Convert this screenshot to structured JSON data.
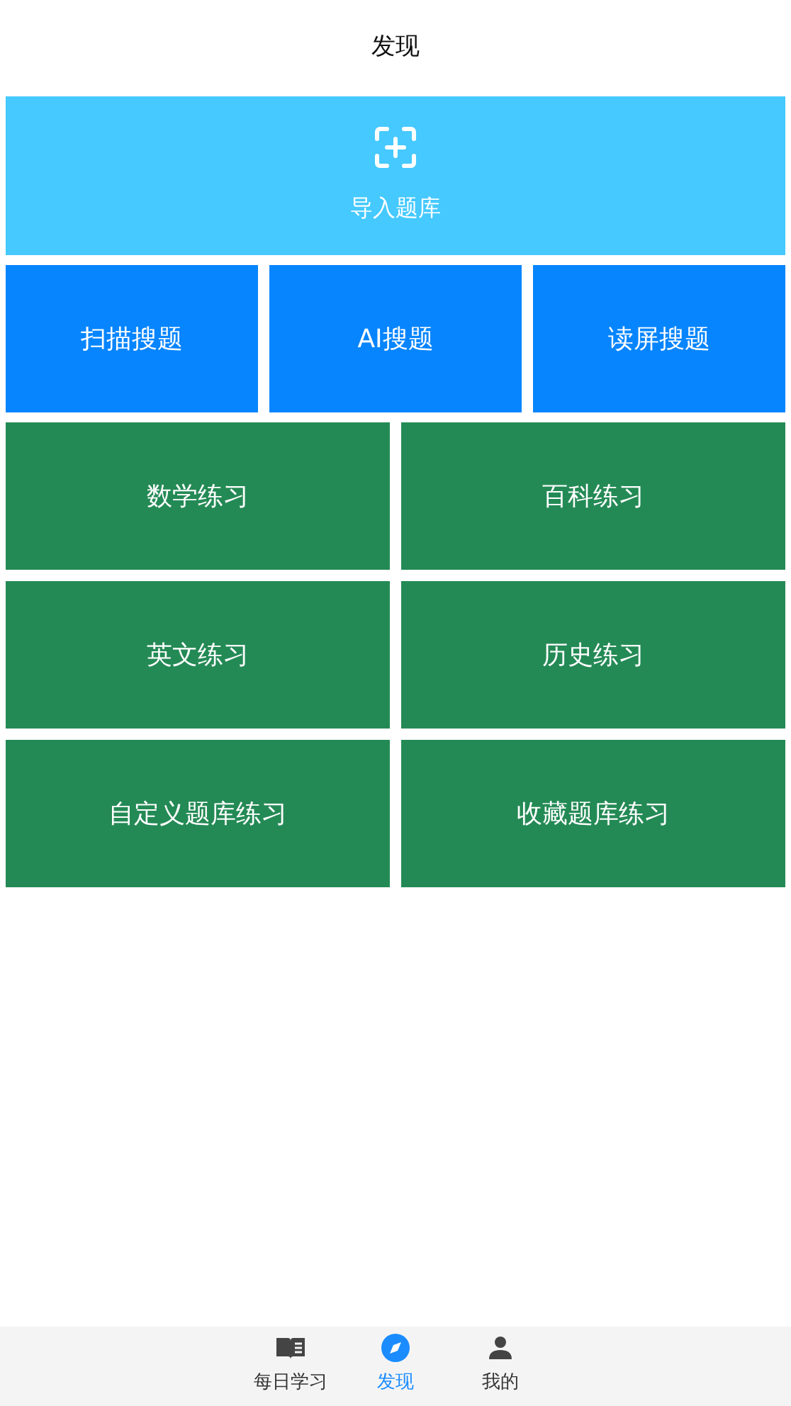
{
  "title": "发现",
  "import_tile": {
    "label": "导入题库"
  },
  "search_tiles": [
    {
      "label": "扫描搜题"
    },
    {
      "label": "AI搜题"
    },
    {
      "label": "读屏搜题"
    }
  ],
  "practice_tiles": [
    {
      "label": "数学练习"
    },
    {
      "label": "百科练习"
    },
    {
      "label": "英文练习"
    },
    {
      "label": "历史练习"
    },
    {
      "label": "自定义题库练习"
    },
    {
      "label": "收藏题库练习"
    }
  ],
  "tab_bar": [
    {
      "kind": "book",
      "label": "每日学习",
      "selected": false
    },
    {
      "kind": "compass",
      "label": "发现",
      "selected": true
    },
    {
      "kind": "person",
      "label": "我的",
      "selected": false
    }
  ]
}
